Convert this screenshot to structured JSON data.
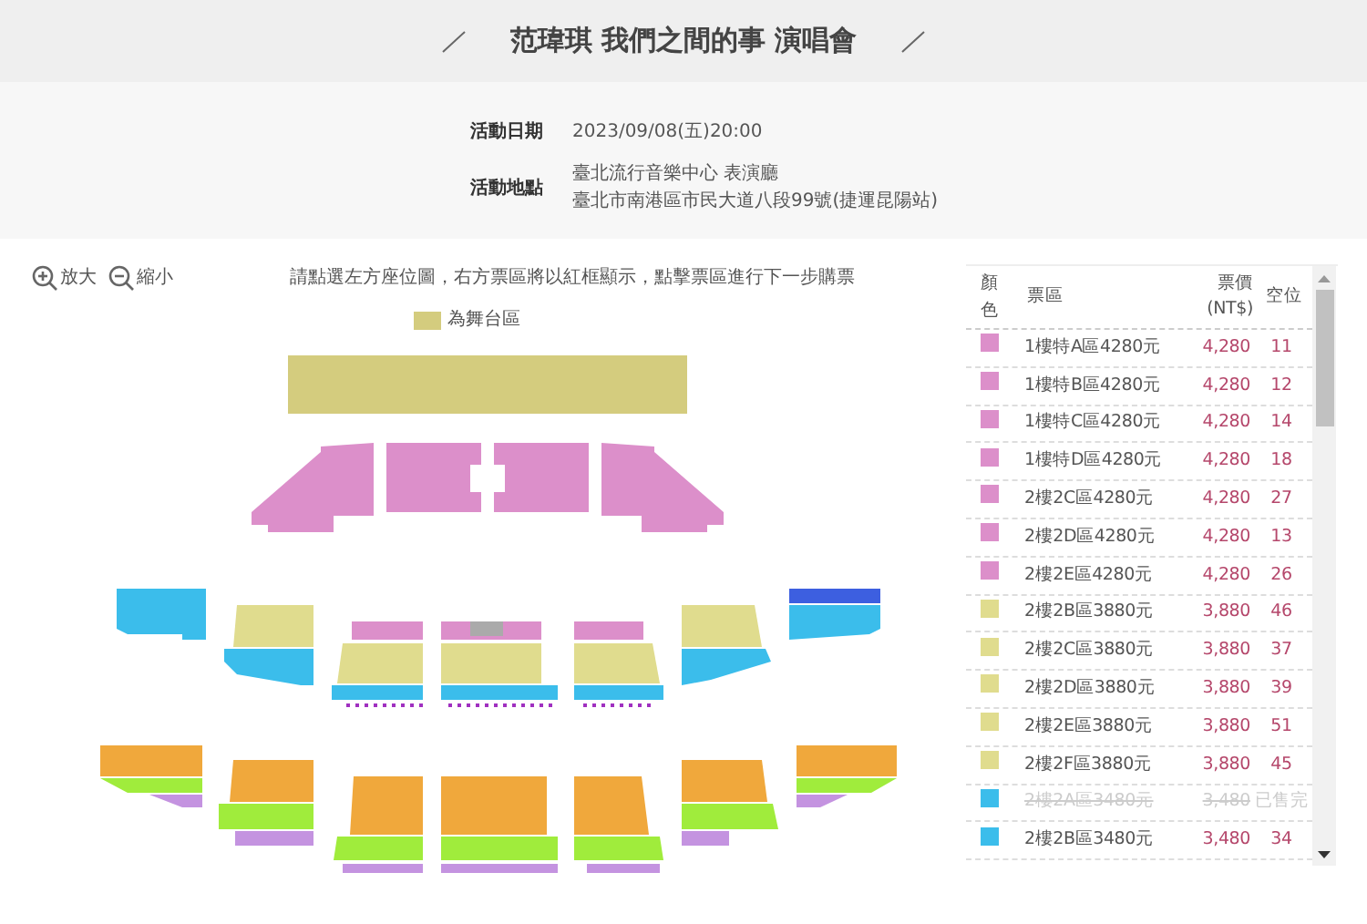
{
  "event_title": "范瑋琪 我們之間的事 演唱會",
  "info": [
    {
      "label": "活動日期",
      "lines": [
        "2023/09/08(五)20:00"
      ]
    },
    {
      "label": "活動地點",
      "lines": [
        "臺北流行音樂中心 表演廳",
        "臺北市南港區市民大道八段99號(捷運昆陽站)"
      ]
    }
  ],
  "zoom_controls": [
    {
      "kind": "zoom_in",
      "label": "放大"
    },
    {
      "kind": "zoom_out",
      "label": "縮小"
    }
  ],
  "instruction": "請點選左方座位圖，右方票區將以紅框顯示，點擊票區進行下一步購票",
  "legend": {
    "color": "#d4cc7e",
    "label": "為舞台區"
  },
  "table": {
    "columns": [
      {
        "label": "顏色"
      },
      {
        "label": "票區"
      },
      {
        "label": "票價",
        "sub": "(NT$)"
      },
      {
        "label": "空位"
      }
    ],
    "rows": [
      {
        "color": "#dc8fca",
        "area": "1樓特A區4280元",
        "price": "4,280",
        "seats": "11",
        "sold_out": false
      },
      {
        "color": "#dc8fca",
        "area": "1樓特B區4280元",
        "price": "4,280",
        "seats": "12",
        "sold_out": false
      },
      {
        "color": "#dc8fca",
        "area": "1樓特C區4280元",
        "price": "4,280",
        "seats": "14",
        "sold_out": false
      },
      {
        "color": "#dc8fca",
        "area": "1樓特D區4280元",
        "price": "4,280",
        "seats": "18",
        "sold_out": false
      },
      {
        "color": "#dc8fca",
        "area": "2樓2C區4280元",
        "price": "4,280",
        "seats": "27",
        "sold_out": false
      },
      {
        "color": "#dc8fca",
        "area": "2樓2D區4280元",
        "price": "4,280",
        "seats": "13",
        "sold_out": false
      },
      {
        "color": "#dc8fca",
        "area": "2樓2E區4280元",
        "price": "4,280",
        "seats": "26",
        "sold_out": false
      },
      {
        "color": "#e0dc8e",
        "area": "2樓2B區3880元",
        "price": "3,880",
        "seats": "46",
        "sold_out": false
      },
      {
        "color": "#e0dc8e",
        "area": "2樓2C區3880元",
        "price": "3,880",
        "seats": "37",
        "sold_out": false
      },
      {
        "color": "#e0dc8e",
        "area": "2樓2D區3880元",
        "price": "3,880",
        "seats": "39",
        "sold_out": false
      },
      {
        "color": "#e0dc8e",
        "area": "2樓2E區3880元",
        "price": "3,880",
        "seats": "51",
        "sold_out": false
      },
      {
        "color": "#e0dc8e",
        "area": "2樓2F區3880元",
        "price": "3,880",
        "seats": "45",
        "sold_out": false
      },
      {
        "color": "#3bbdeb",
        "area": "2樓2A區3480元",
        "price": "3,480",
        "seats": "已售完",
        "sold_out": true
      },
      {
        "color": "#3bbdeb",
        "area": "2樓2B區3480元",
        "price": "3,480",
        "seats": "34",
        "sold_out": false
      }
    ]
  }
}
